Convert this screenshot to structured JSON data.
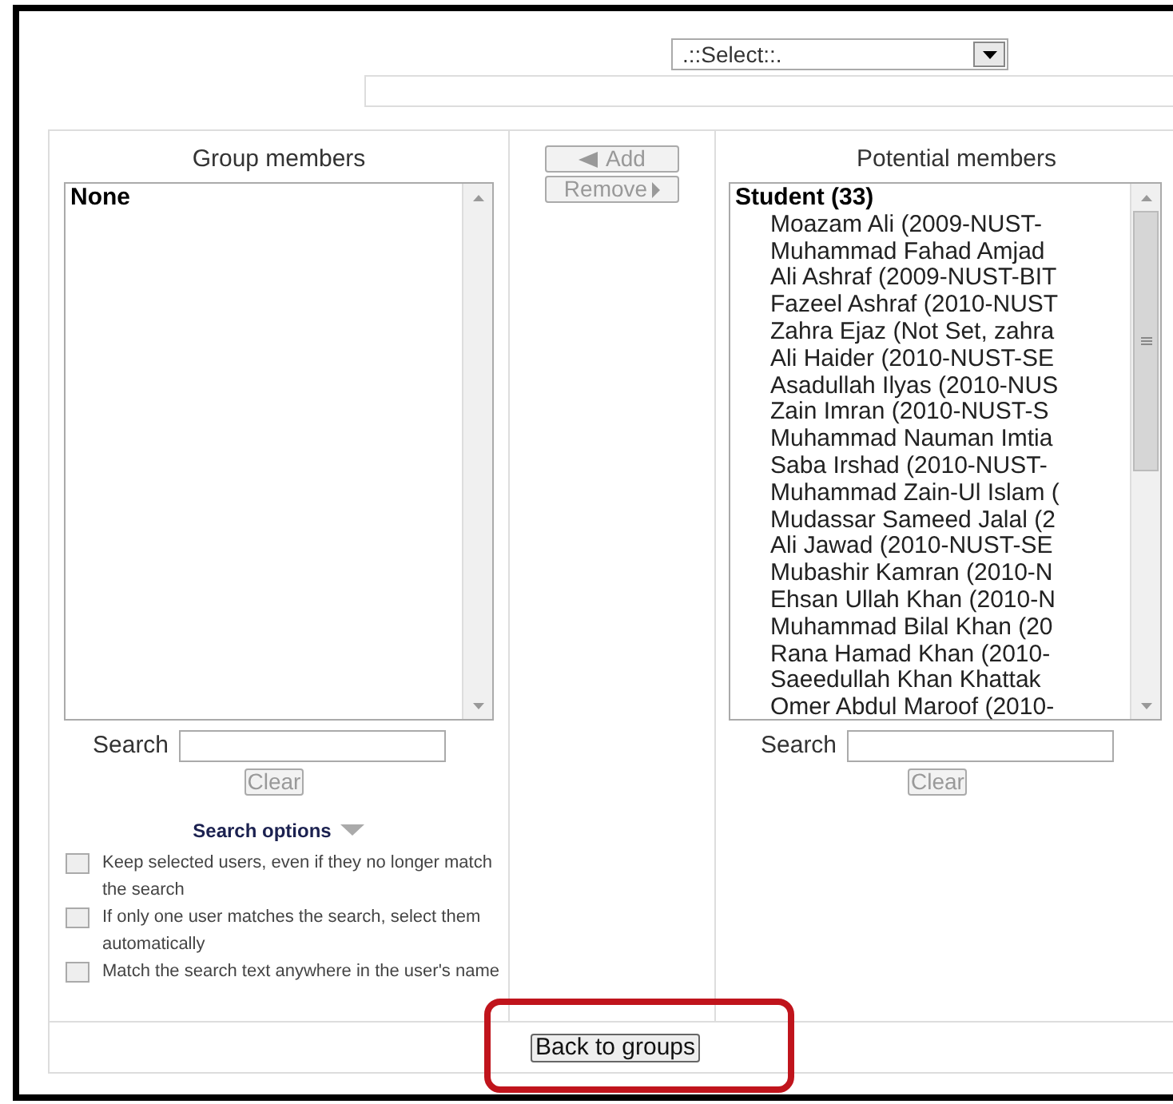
{
  "group_select": {
    "value": ".::Select::."
  },
  "group_members": {
    "heading": "Group members",
    "listbox": {
      "group_label": "None"
    },
    "search_label": "Search",
    "clear_button": "Clear",
    "search_options": {
      "title": "Search options",
      "options": [
        {
          "label": "Keep selected users, even if they no longer match the search",
          "checked": false
        },
        {
          "label": "If only one user matches the search, select them automatically",
          "checked": false
        },
        {
          "label": "Match the search text anywhere in the user's name",
          "checked": false
        }
      ]
    }
  },
  "actions": {
    "add_button": "Add",
    "remove_button": "Remove"
  },
  "potential_members": {
    "heading": "Potential members",
    "listbox": {
      "group_label": "Student (33)",
      "items": [
        "Moazam Ali (2009-NUST-",
        "Muhammad Fahad Amjad",
        "Ali Ashraf (2009-NUST-BIT",
        "Fazeel Ashraf (2010-NUST",
        "Zahra Ejaz (Not Set, zahra",
        "Ali Haider (2010-NUST-SE",
        "Asadullah Ilyas (2010-NUS",
        "Zain Imran (2010-NUST-S",
        "Muhammad Nauman Imtia",
        "Saba Irshad (2010-NUST-",
        "Muhammad Zain-Ul Islam (",
        "Mudassar Sameed Jalal (2",
        "Ali Jawad (2010-NUST-SE",
        "Mubashir Kamran (2010-N",
        "Ehsan Ullah Khan (2010-N",
        "Muhammad Bilal Khan (20",
        "Rana Hamad Khan (2010-",
        "Saeedullah Khan Khattak",
        "Omer Abdul Maroof (2010-"
      ]
    },
    "search_label": "Search",
    "clear_button": "Clear"
  },
  "footer": {
    "back_button": "Back to groups"
  }
}
